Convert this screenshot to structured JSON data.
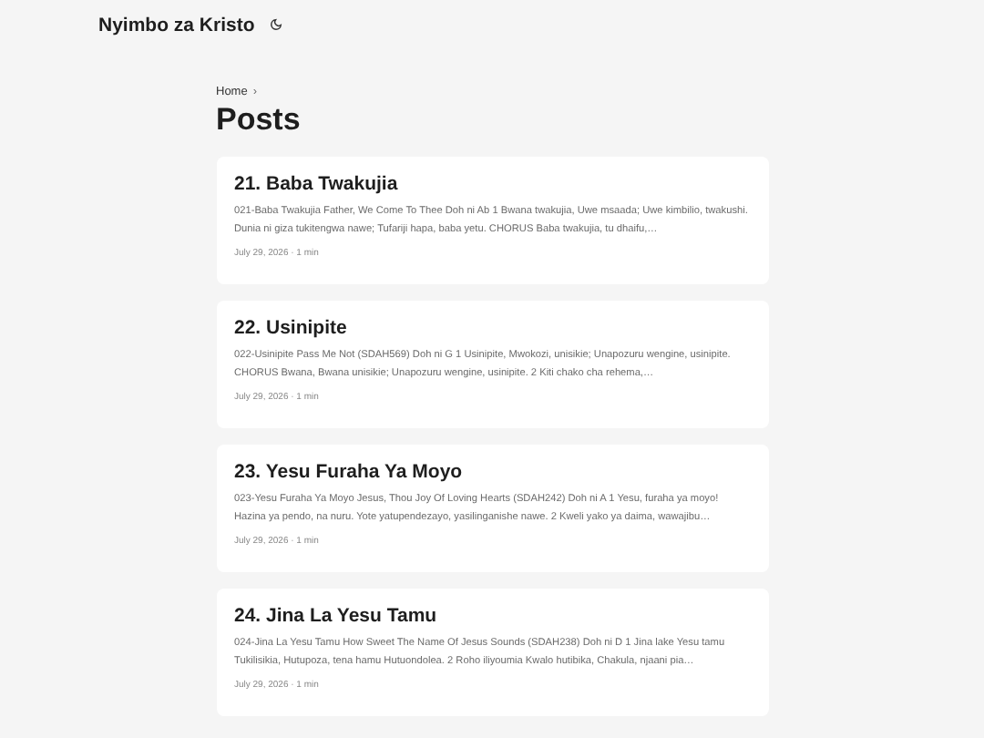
{
  "header": {
    "site_title": "Nyimbo za Kristo",
    "dark_mode": false
  },
  "breadcrumb": {
    "items": [
      "Home"
    ],
    "separator": "›"
  },
  "page_title": "Posts",
  "posts": [
    {
      "title": "21. Baba Twakujia",
      "summary": "021-Baba Twakujia Father, We Come To Thee Doh ni Ab 1 Bwana twakujia, Uwe msaada; Uwe kimbilio, twakushi. Dunia ni giza tukitengwa nawe; Tufariji hapa, baba yetu. CHORUS Baba twakujia, tu dhaifu,…",
      "meta": "July 29, 2026 · 1 min"
    },
    {
      "title": "22. Usinipite",
      "summary": "022-Usinipite Pass Me Not (SDAH569) Doh ni G 1 Usinipite, Mwokozi, unisikie; Unapozuru wengine, usinipite. CHORUS Bwana, Bwana unisikie; Unapozuru wengine, usinipite. 2 Kiti chako cha rehema,…",
      "meta": "July 29, 2026 · 1 min"
    },
    {
      "title": "23. Yesu Furaha Ya Moyo",
      "summary": "023-Yesu Furaha Ya Moyo Jesus, Thou Joy Of Loving Hearts (SDAH242) Doh ni A 1 Yesu, furaha ya moyo! Hazina ya pendo, na nuru. Yote yatupendezayo, yasilinganishe nawe. 2 Kweli yako ya daima, wawajibu…",
      "meta": "July 29, 2026 · 1 min"
    },
    {
      "title": "24. Jina La Yesu Tamu",
      "summary": "024-Jina La Yesu Tamu How Sweet The Name Of Jesus Sounds (SDAH238) Doh ni D 1 Jina lake Yesu tamu Tukilisikia, Hutupoza, tena hamu Hutuondolea. 2 Roho iliyoumia Kwalo hutibika, Chakula, njaani pia…",
      "meta": "July 29, 2026 · 1 min"
    }
  ]
}
